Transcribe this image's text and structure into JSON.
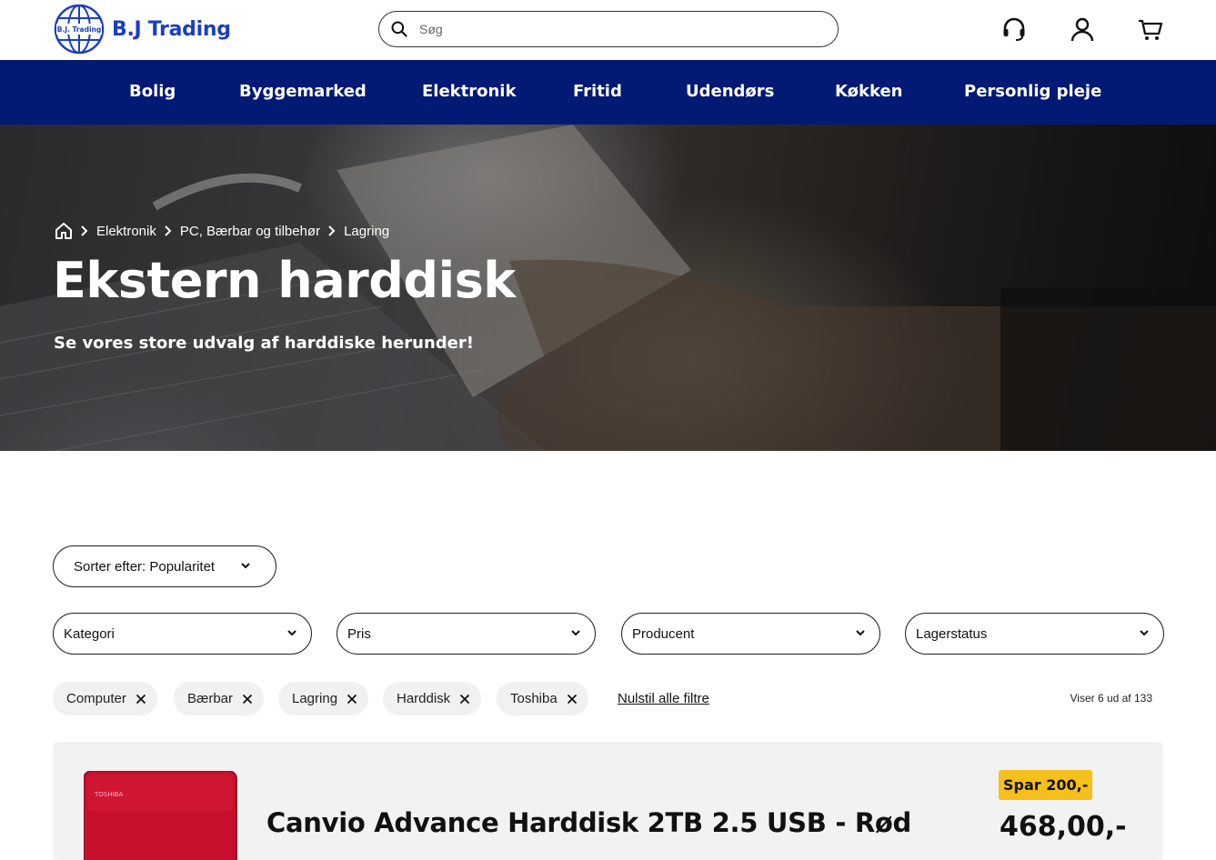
{
  "brand": {
    "name": "B.J Trading",
    "badge_text": "B.J. Trading"
  },
  "search": {
    "placeholder": "Søg"
  },
  "header_icons": [
    "headset-icon",
    "user-icon",
    "cart-icon"
  ],
  "nav": {
    "items": [
      "Bolig",
      "Byggemarked",
      "Elektronik",
      "Fritid",
      "Udendørs",
      "Køkken",
      "Personlig pleje"
    ]
  },
  "hero": {
    "breadcrumb": [
      "Elektronik",
      "PC, Bærbar og tilbehør",
      "Lagring"
    ],
    "title": "Ekstern harddisk",
    "subtitle": "Se vores store udvalg af harddiske herunder!"
  },
  "sort": {
    "label": "Sorter efter: Popularitet"
  },
  "filters": {
    "dropdowns": [
      "Kategori",
      "Pris",
      "Producent",
      "Lagerstatus"
    ],
    "active_chips": [
      "Computer",
      "Bærbar",
      "Lagring",
      "Harddisk",
      "Toshiba"
    ],
    "reset_label": "Nulstil alle filtre",
    "result_count": "Viser 6 ud af 133"
  },
  "product": {
    "title": "Canvio Advance Harddisk 2TB 2.5 USB - Rød",
    "image_label": "TOSHIBA",
    "save_badge": "Spar 200,-",
    "price": "468,00,-",
    "colors": {
      "badge": "#f5c01c",
      "product": "#c8102e"
    }
  },
  "colors": {
    "nav_bg": "#021a73",
    "brand": "#1c3fbf"
  }
}
